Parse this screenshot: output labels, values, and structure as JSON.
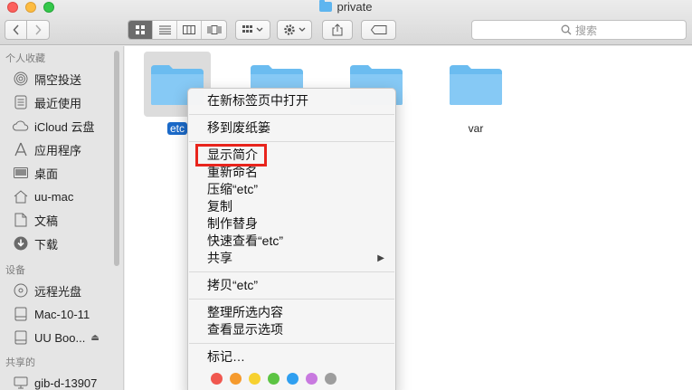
{
  "window": {
    "title": "private"
  },
  "toolbar": {
    "search_placeholder": "搜索"
  },
  "sidebar": {
    "favorites_header": "个人收藏",
    "favorites": [
      {
        "label": "隔空投送",
        "icon": "airdrop-icon"
      },
      {
        "label": "最近使用",
        "icon": "recents-icon"
      },
      {
        "label": "iCloud 云盘",
        "icon": "cloud-icon"
      },
      {
        "label": "应用程序",
        "icon": "applications-icon"
      },
      {
        "label": "桌面",
        "icon": "desktop-icon"
      },
      {
        "label": "uu-mac",
        "icon": "home-icon"
      },
      {
        "label": "文稿",
        "icon": "documents-icon"
      },
      {
        "label": "下载",
        "icon": "downloads-icon"
      }
    ],
    "devices_header": "设备",
    "devices": [
      {
        "label": "远程光盘",
        "icon": "optical-disc-icon"
      },
      {
        "label": "Mac-10-11",
        "icon": "drive-icon"
      },
      {
        "label": "UU Boo...",
        "icon": "drive-icon"
      }
    ],
    "shared_header": "共享的",
    "shared": [
      {
        "label": "gib-d-13907",
        "icon": "network-icon"
      }
    ]
  },
  "files": [
    {
      "name": "etc",
      "selected": true
    },
    {
      "name": "",
      "selected": false
    },
    {
      "name": "",
      "selected": false
    },
    {
      "name": "var",
      "selected": false
    }
  ],
  "context_menu": {
    "open_new_tab": "在新标签页中打开",
    "move_to_trash": "移到废纸篓",
    "get_info": "显示简介",
    "rename": "重新命名",
    "compress": "压缩“etc”",
    "duplicate": "复制",
    "make_alias": "制作替身",
    "quick_look": "快速查看“etc”",
    "share": "共享",
    "copy": "拷贝“etc”",
    "clean_up": "整理所选内容",
    "view_options": "查看显示选项",
    "tags": "标记…",
    "tag_colors": [
      "#f0574f",
      "#f59a2d",
      "#f7d130",
      "#5cc443",
      "#2f9ff0",
      "#c879df",
      "#9d9d9d"
    ]
  },
  "colors": {
    "selection": "#1b6ac9",
    "folder": "#5eb5ef",
    "highlight": "#e8241c"
  }
}
